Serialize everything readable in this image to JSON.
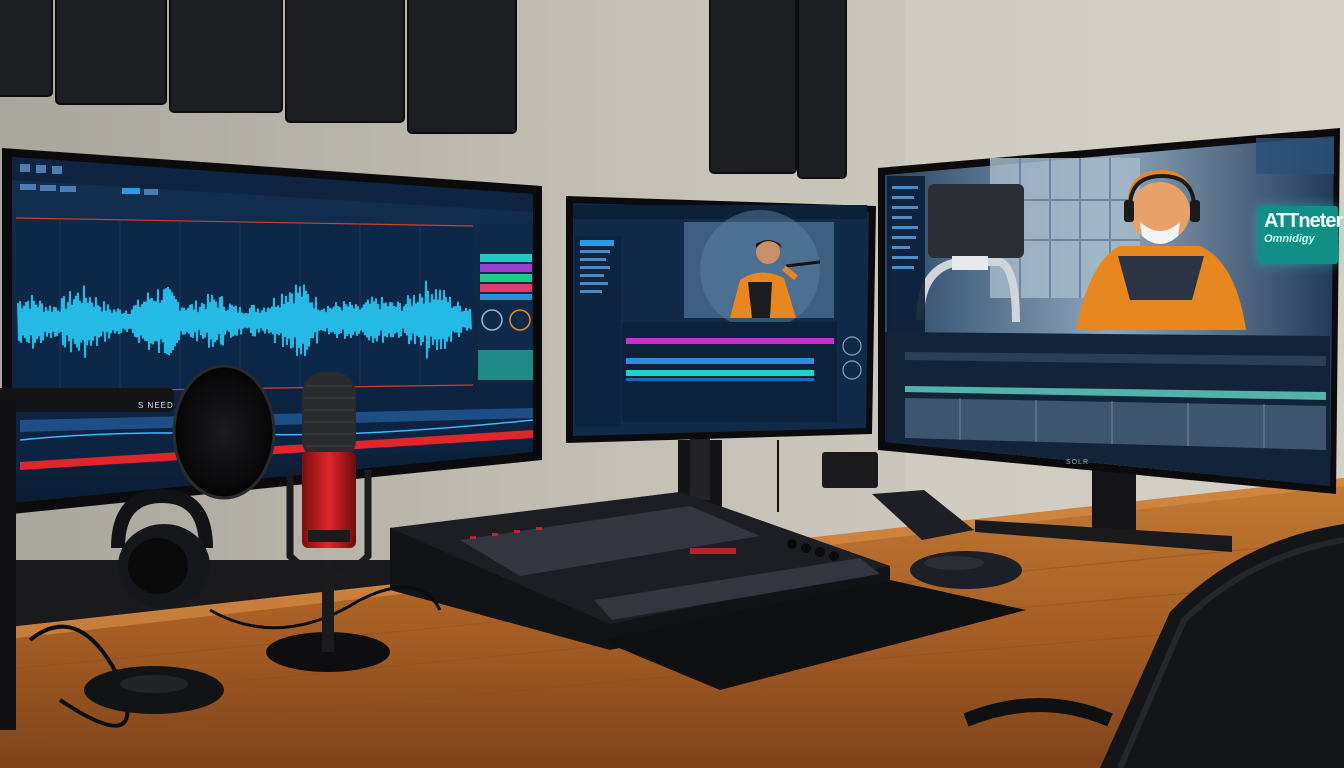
{
  "scene": {
    "studio_sign": {
      "line1": "ATTneter",
      "line2": "Omnidigy"
    },
    "panel_tag": "S NEED",
    "monitor_badge": "SOLR"
  },
  "colors": {
    "wall": "#b9b4a8",
    "desk": "#b36a2a",
    "waveform": "#25b9e6",
    "accent_red": "#e0262b",
    "timeline_magenta": "#c530d9",
    "timeline_cyan": "#23d4c6",
    "jacket_orange": "#e8871f"
  },
  "icons": [
    "microphone-icon",
    "pop-filter-icon",
    "headphones-icon",
    "keyboard-icon",
    "mouse-icon",
    "office-chair-icon"
  ]
}
